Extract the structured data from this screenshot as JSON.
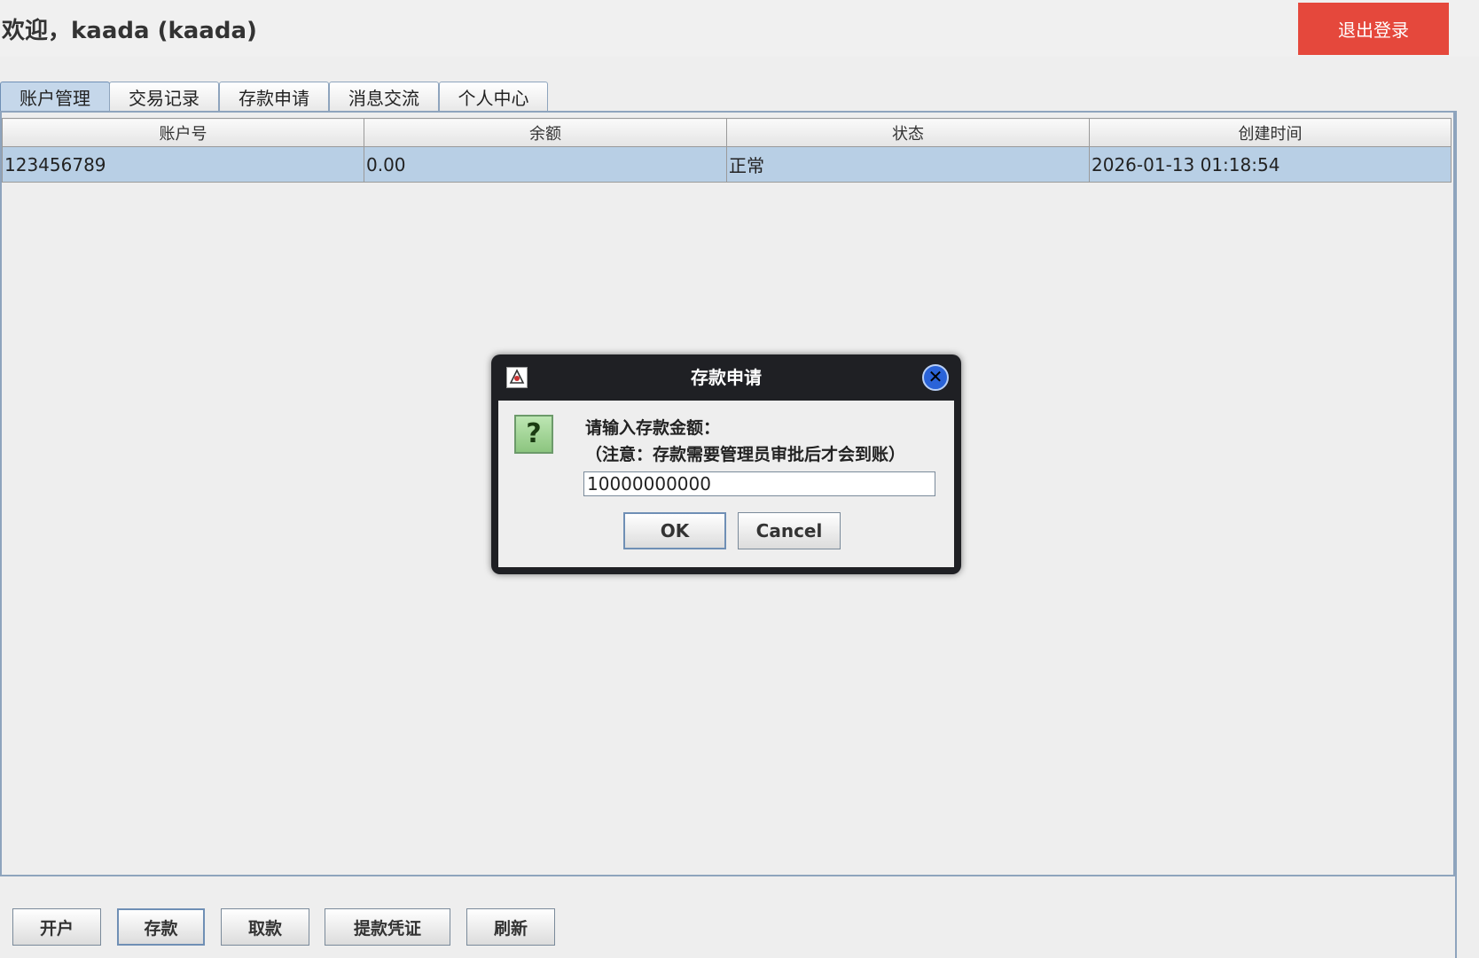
{
  "header": {
    "welcome": "欢迎，kaada (kaada)",
    "logout_label": "退出登录"
  },
  "tabs": [
    {
      "label": "账户管理"
    },
    {
      "label": "交易记录"
    },
    {
      "label": "存款申请"
    },
    {
      "label": "消息交流"
    },
    {
      "label": "个人中心"
    }
  ],
  "table": {
    "columns": [
      "账户号",
      "余额",
      "状态",
      "创建时间"
    ],
    "rows": [
      {
        "account": "123456789",
        "balance": "0.00",
        "status": "正常",
        "created": "2026-01-13 01:18:54"
      }
    ]
  },
  "bottom_buttons": [
    "开户",
    "存款",
    "取款",
    "提款凭证",
    "刷新"
  ],
  "dialog": {
    "title": "存款申请",
    "message_line1": "请输入存款金额：",
    "message_line2": "（注意：存款需要管理员审批后才会到账）",
    "amount_value": "10000000000",
    "ok_label": "OK",
    "cancel_label": "Cancel",
    "question_mark": "?",
    "close_glyph": "✕"
  },
  "colors": {
    "logout_bg": "#e5483c",
    "selected_row": "#b8cfe5",
    "dialog_frame": "#1f2024",
    "close_button": "#2a63d8"
  },
  "icons": [
    "java-app-icon",
    "close-icon",
    "question-icon"
  ]
}
